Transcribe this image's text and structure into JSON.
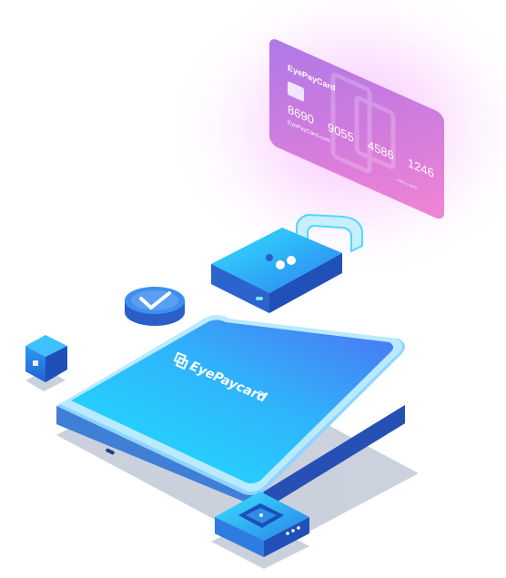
{
  "illustration": {
    "card": {
      "brand": "EyePayCard",
      "number_groups": [
        "8690",
        "9055",
        "4586",
        "1246"
      ],
      "website": "EyePayCard.com",
      "small_text": "valid to 08/11"
    },
    "phone": {
      "brand": "EyePaycard",
      "trademark": "TM"
    },
    "colors": {
      "card_gradient_start": "#b06be0",
      "card_gradient_end": "#f07fd4",
      "phone_screen_start": "#1fd6ff",
      "phone_screen_end": "#4f7cf5",
      "phone_body": "#2a65c7",
      "glow": "#f6a8ff"
    },
    "icons": [
      "credit-card-icon",
      "padlock-icon",
      "checkmark-badge-icon",
      "cube-icon",
      "chip-device-icon"
    ]
  }
}
